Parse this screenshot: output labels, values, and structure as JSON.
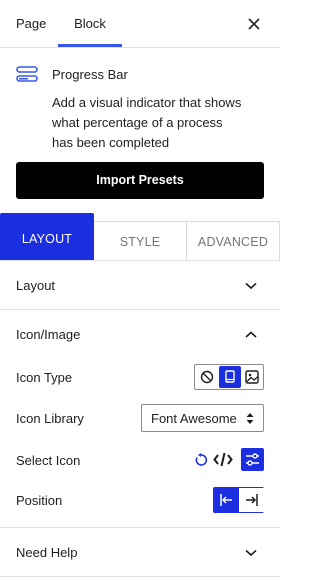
{
  "header": {
    "tabs": [
      {
        "label": "Page"
      },
      {
        "label": "Block"
      }
    ]
  },
  "block": {
    "title": "Progress Bar",
    "description": "Add a visual indicator that shows what percentage of a process has been completed",
    "icon": "progress-bar-icon"
  },
  "import_button": {
    "label": "Import Presets"
  },
  "sub_tabs": [
    {
      "label": "LAYOUT"
    },
    {
      "label": "STYLE"
    },
    {
      "label": "ADVANCED"
    }
  ],
  "panels": {
    "layout": {
      "label": "Layout",
      "expanded": false
    },
    "icon_image": {
      "label": "Icon/Image",
      "expanded": true,
      "icon_type": {
        "label": "Icon Type",
        "selected": "icon",
        "options": [
          "none-icon",
          "icon-icon",
          "image-icon"
        ]
      },
      "icon_library": {
        "label": "Icon Library",
        "value": "Font Awesome"
      },
      "select_icon": {
        "label": "Select Icon"
      },
      "position": {
        "label": "Position",
        "selected": "left"
      }
    },
    "need_help": {
      "label": "Need Help",
      "expanded": false
    }
  },
  "colors": {
    "accent": "#1b2ee0",
    "wp_blue": "#3858e9",
    "button_bg": "#000000"
  }
}
